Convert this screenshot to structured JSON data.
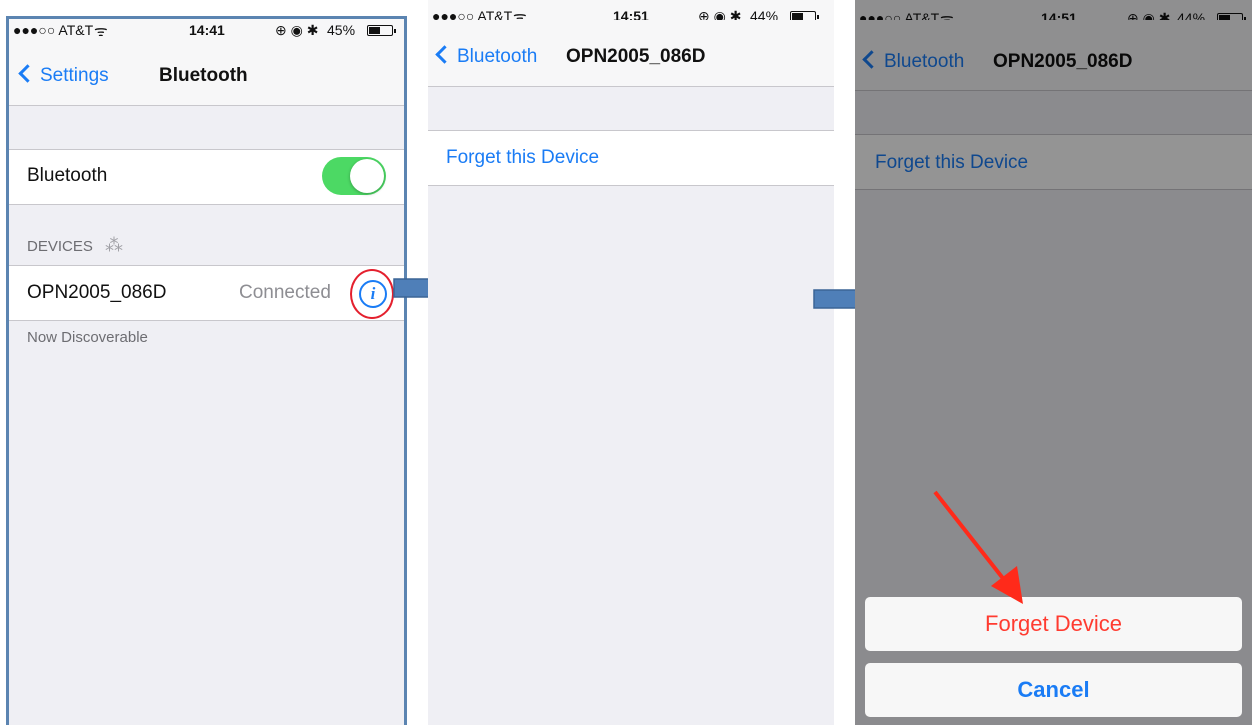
{
  "screen1": {
    "status": {
      "carrier": "●●●○○ AT&T",
      "time": "14:41",
      "icons": "⊕ ◉ ✱",
      "battery": "45%",
      "battery_level": 0.45
    },
    "nav": {
      "back_label": "Settings",
      "title": "Bluetooth"
    },
    "bluetooth_row": {
      "label": "Bluetooth",
      "toggle_on": true
    },
    "devices_header": "DEVICES",
    "device": {
      "name": "OPN2005_086D",
      "status": "Connected"
    },
    "footer_note": "Now Discoverable"
  },
  "screen2": {
    "status": {
      "carrier": "●●●○○ AT&T",
      "time": "14:51",
      "icons": "⊕ ◉ ✱",
      "battery": "44%",
      "battery_level": 0.44
    },
    "nav": {
      "back_label": "Bluetooth",
      "title": "OPN2005_086D"
    },
    "forget_row": "Forget this Device"
  },
  "screen3": {
    "status": {
      "carrier": "●●●○○ AT&T",
      "time": "14:51",
      "icons": "⊕ ◉ ✱",
      "battery": "44%",
      "battery_level": 0.44
    },
    "nav": {
      "back_label": "Bluetooth",
      "title": "OPN2005_086D"
    },
    "forget_row": "Forget this Device",
    "action_sheet": {
      "destructive_label": "Forget Device",
      "cancel_label": "Cancel"
    }
  },
  "colors": {
    "accent": "#1a7cf5",
    "toggle_on": "#4cd964",
    "destructive": "#ff3b30",
    "highlight": "#e4202e",
    "flow_arrow": "#4f7fb8"
  },
  "icons": [
    "wifi-icon",
    "alarm-icon",
    "bluetooth-icon",
    "battery-icon",
    "chevron-left-icon",
    "info-icon",
    "spinner-icon",
    "flow-arrow-icon",
    "pointer-arrow-icon"
  ]
}
